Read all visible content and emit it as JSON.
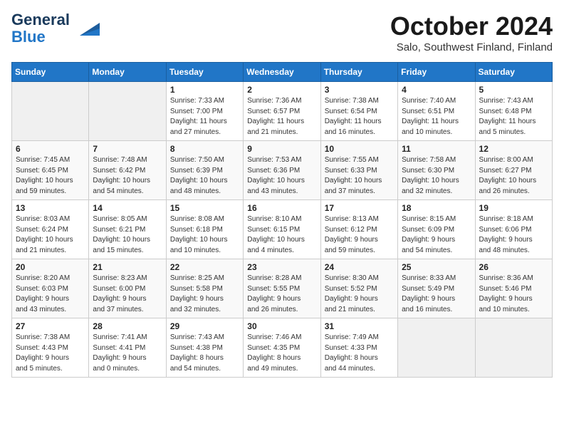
{
  "header": {
    "logo_line1": "General",
    "logo_line2": "Blue",
    "month": "October 2024",
    "location": "Salo, Southwest Finland, Finland"
  },
  "weekdays": [
    "Sunday",
    "Monday",
    "Tuesday",
    "Wednesday",
    "Thursday",
    "Friday",
    "Saturday"
  ],
  "weeks": [
    [
      {
        "day": "",
        "info": ""
      },
      {
        "day": "",
        "info": ""
      },
      {
        "day": "1",
        "info": "Sunrise: 7:33 AM\nSunset: 7:00 PM\nDaylight: 11 hours\nand 27 minutes."
      },
      {
        "day": "2",
        "info": "Sunrise: 7:36 AM\nSunset: 6:57 PM\nDaylight: 11 hours\nand 21 minutes."
      },
      {
        "day": "3",
        "info": "Sunrise: 7:38 AM\nSunset: 6:54 PM\nDaylight: 11 hours\nand 16 minutes."
      },
      {
        "day": "4",
        "info": "Sunrise: 7:40 AM\nSunset: 6:51 PM\nDaylight: 11 hours\nand 10 minutes."
      },
      {
        "day": "5",
        "info": "Sunrise: 7:43 AM\nSunset: 6:48 PM\nDaylight: 11 hours\nand 5 minutes."
      }
    ],
    [
      {
        "day": "6",
        "info": "Sunrise: 7:45 AM\nSunset: 6:45 PM\nDaylight: 10 hours\nand 59 minutes."
      },
      {
        "day": "7",
        "info": "Sunrise: 7:48 AM\nSunset: 6:42 PM\nDaylight: 10 hours\nand 54 minutes."
      },
      {
        "day": "8",
        "info": "Sunrise: 7:50 AM\nSunset: 6:39 PM\nDaylight: 10 hours\nand 48 minutes."
      },
      {
        "day": "9",
        "info": "Sunrise: 7:53 AM\nSunset: 6:36 PM\nDaylight: 10 hours\nand 43 minutes."
      },
      {
        "day": "10",
        "info": "Sunrise: 7:55 AM\nSunset: 6:33 PM\nDaylight: 10 hours\nand 37 minutes."
      },
      {
        "day": "11",
        "info": "Sunrise: 7:58 AM\nSunset: 6:30 PM\nDaylight: 10 hours\nand 32 minutes."
      },
      {
        "day": "12",
        "info": "Sunrise: 8:00 AM\nSunset: 6:27 PM\nDaylight: 10 hours\nand 26 minutes."
      }
    ],
    [
      {
        "day": "13",
        "info": "Sunrise: 8:03 AM\nSunset: 6:24 PM\nDaylight: 10 hours\nand 21 minutes."
      },
      {
        "day": "14",
        "info": "Sunrise: 8:05 AM\nSunset: 6:21 PM\nDaylight: 10 hours\nand 15 minutes."
      },
      {
        "day": "15",
        "info": "Sunrise: 8:08 AM\nSunset: 6:18 PM\nDaylight: 10 hours\nand 10 minutes."
      },
      {
        "day": "16",
        "info": "Sunrise: 8:10 AM\nSunset: 6:15 PM\nDaylight: 10 hours\nand 4 minutes."
      },
      {
        "day": "17",
        "info": "Sunrise: 8:13 AM\nSunset: 6:12 PM\nDaylight: 9 hours\nand 59 minutes."
      },
      {
        "day": "18",
        "info": "Sunrise: 8:15 AM\nSunset: 6:09 PM\nDaylight: 9 hours\nand 54 minutes."
      },
      {
        "day": "19",
        "info": "Sunrise: 8:18 AM\nSunset: 6:06 PM\nDaylight: 9 hours\nand 48 minutes."
      }
    ],
    [
      {
        "day": "20",
        "info": "Sunrise: 8:20 AM\nSunset: 6:03 PM\nDaylight: 9 hours\nand 43 minutes."
      },
      {
        "day": "21",
        "info": "Sunrise: 8:23 AM\nSunset: 6:00 PM\nDaylight: 9 hours\nand 37 minutes."
      },
      {
        "day": "22",
        "info": "Sunrise: 8:25 AM\nSunset: 5:58 PM\nDaylight: 9 hours\nand 32 minutes."
      },
      {
        "day": "23",
        "info": "Sunrise: 8:28 AM\nSunset: 5:55 PM\nDaylight: 9 hours\nand 26 minutes."
      },
      {
        "day": "24",
        "info": "Sunrise: 8:30 AM\nSunset: 5:52 PM\nDaylight: 9 hours\nand 21 minutes."
      },
      {
        "day": "25",
        "info": "Sunrise: 8:33 AM\nSunset: 5:49 PM\nDaylight: 9 hours\nand 16 minutes."
      },
      {
        "day": "26",
        "info": "Sunrise: 8:36 AM\nSunset: 5:46 PM\nDaylight: 9 hours\nand 10 minutes."
      }
    ],
    [
      {
        "day": "27",
        "info": "Sunrise: 7:38 AM\nSunset: 4:43 PM\nDaylight: 9 hours\nand 5 minutes."
      },
      {
        "day": "28",
        "info": "Sunrise: 7:41 AM\nSunset: 4:41 PM\nDaylight: 9 hours\nand 0 minutes."
      },
      {
        "day": "29",
        "info": "Sunrise: 7:43 AM\nSunset: 4:38 PM\nDaylight: 8 hours\nand 54 minutes."
      },
      {
        "day": "30",
        "info": "Sunrise: 7:46 AM\nSunset: 4:35 PM\nDaylight: 8 hours\nand 49 minutes."
      },
      {
        "day": "31",
        "info": "Sunrise: 7:49 AM\nSunset: 4:33 PM\nDaylight: 8 hours\nand 44 minutes."
      },
      {
        "day": "",
        "info": ""
      },
      {
        "day": "",
        "info": ""
      }
    ]
  ]
}
